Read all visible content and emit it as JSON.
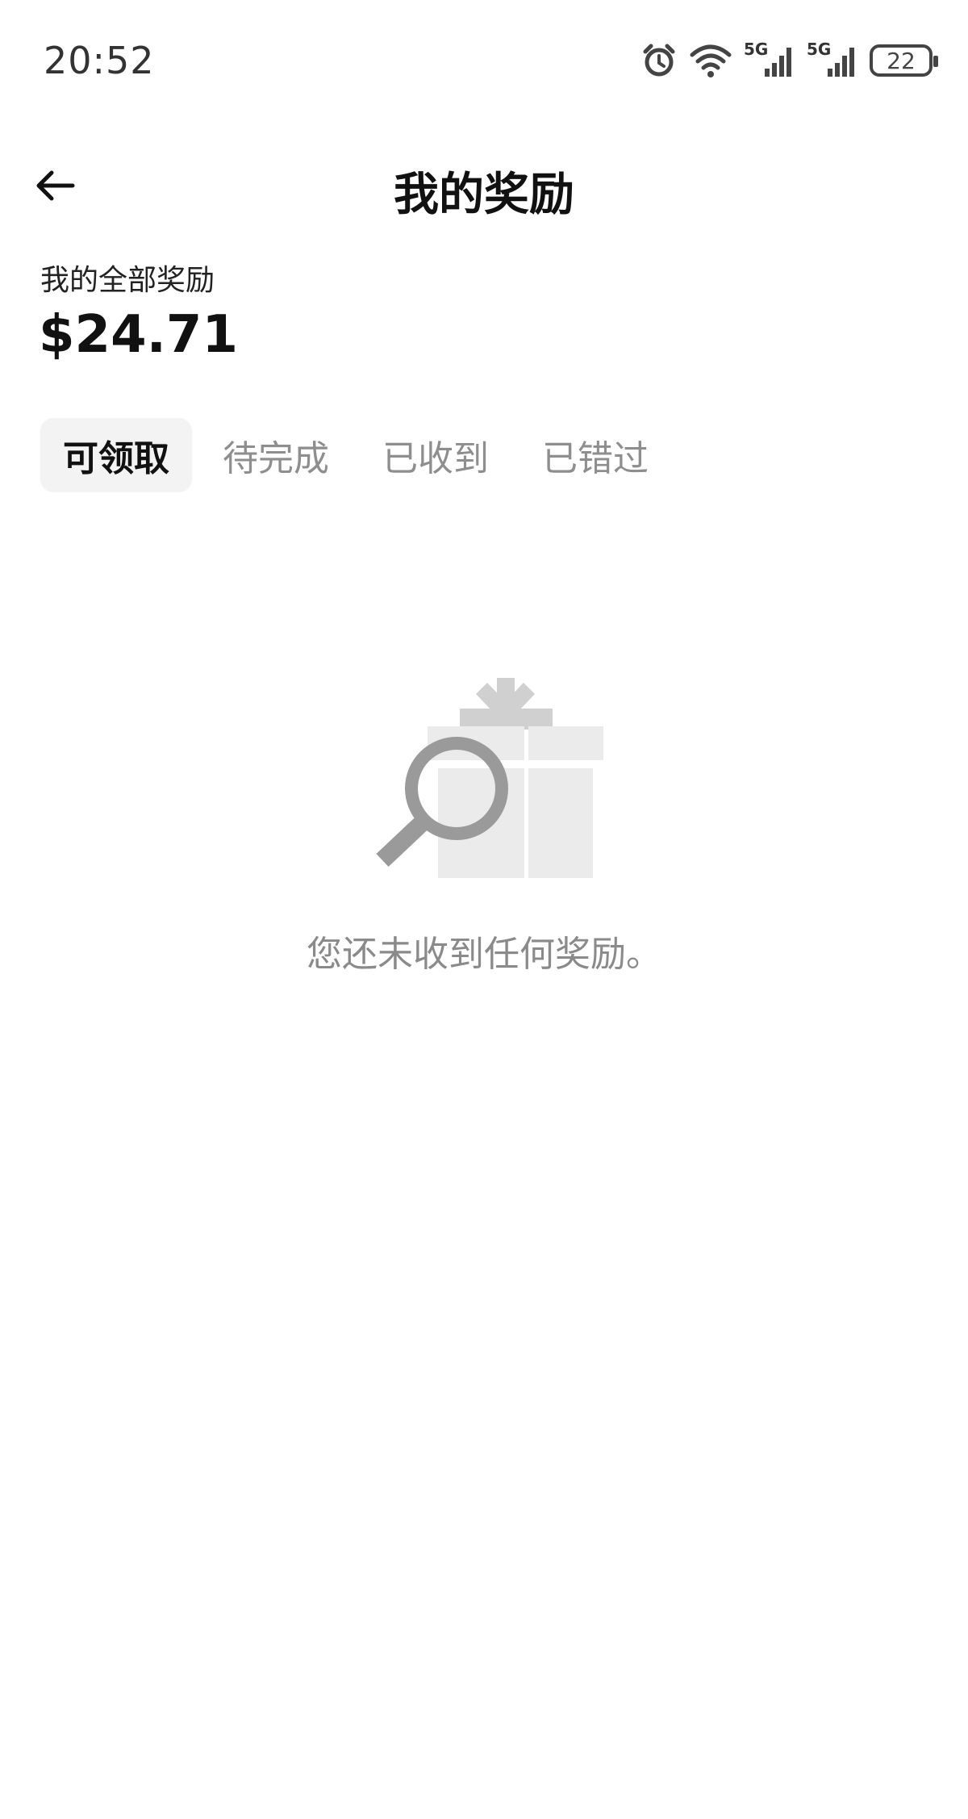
{
  "status_bar": {
    "time": "20:52",
    "network_1": "5G",
    "network_2": "5G",
    "battery_level": "22"
  },
  "header": {
    "title": "我的奖励"
  },
  "summary": {
    "label": "我的全部奖励",
    "amount": "$24.71"
  },
  "tabs": [
    {
      "label": "可领取",
      "active": true
    },
    {
      "label": "待完成",
      "active": false
    },
    {
      "label": "已收到",
      "active": false
    },
    {
      "label": "已错过",
      "active": false
    }
  ],
  "empty_state": {
    "message": "您还未收到任何奖励。"
  },
  "icons": {
    "status": [
      "alarm-icon",
      "wifi-icon",
      "signal-icon",
      "signal-icon",
      "battery-icon"
    ],
    "back": "back-arrow-icon",
    "empty": "gift-search-icon"
  },
  "colors": {
    "active_tab_bg": "#f3f3f3",
    "inactive_tab_text": "#8e8e8e",
    "empty_text": "#8a8a8a"
  }
}
